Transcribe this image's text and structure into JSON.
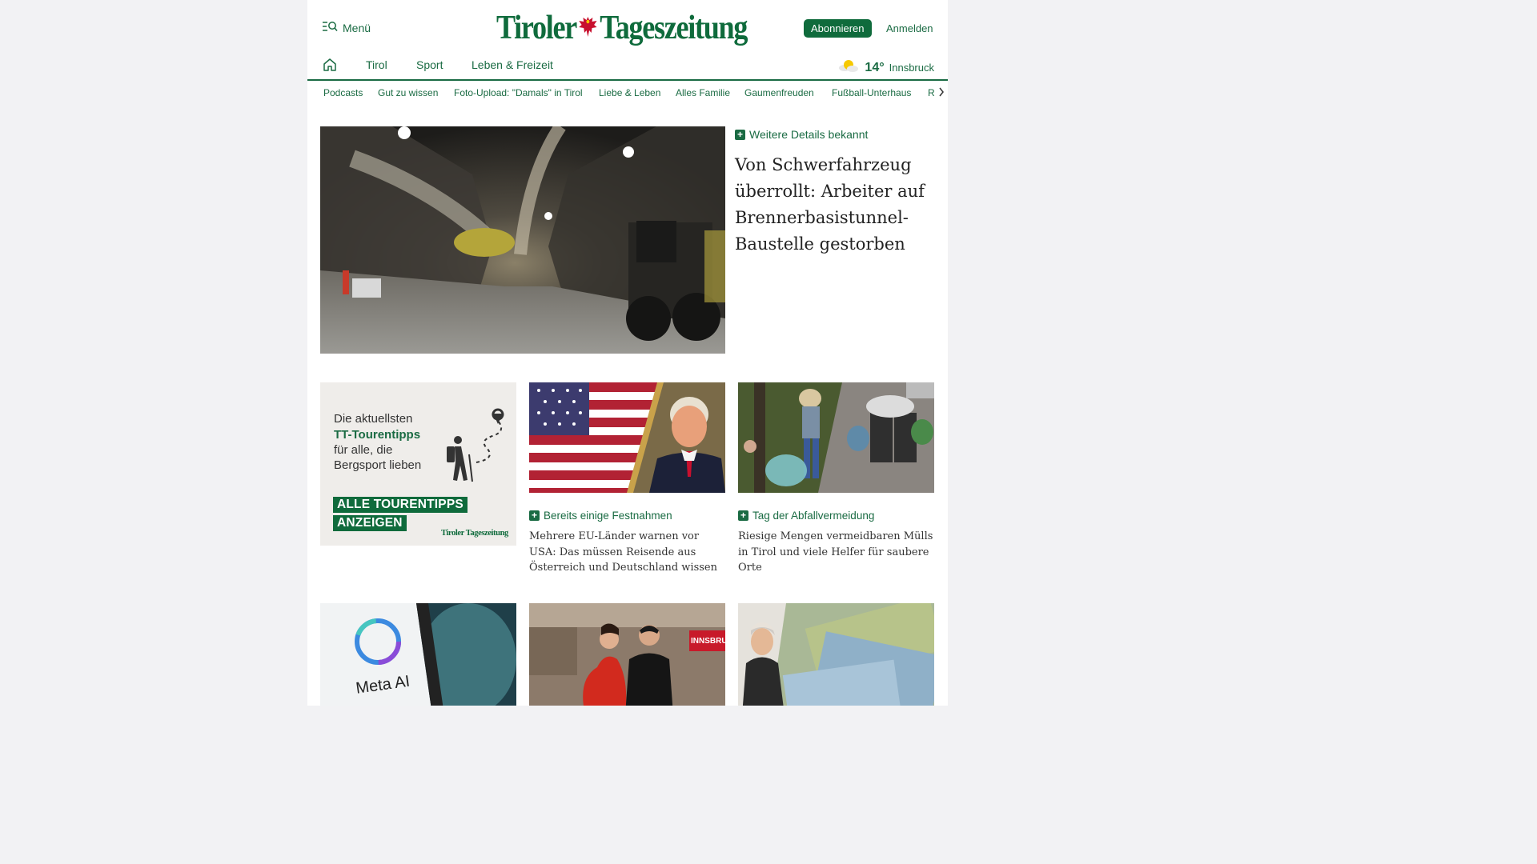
{
  "header": {
    "menu_label": "Menü",
    "logo_left": "Tiroler",
    "logo_right": "Tageszeitung",
    "subscribe_label": "Abonnieren",
    "login_label": "Anmelden"
  },
  "nav": {
    "items": [
      "Tirol",
      "Sport",
      "Leben & Freizeit"
    ]
  },
  "weather": {
    "temp": "14°",
    "city": "Innsbruck"
  },
  "subnav": {
    "items": [
      "Podcasts",
      "Gut zu wissen",
      "Foto-Upload: \"Damals\" in Tirol",
      "Liebe & Leben",
      "Alles Familie",
      "Gaumenfreuden",
      "Fußball-Unterhaus",
      "R"
    ]
  },
  "hero": {
    "kicker": "Weitere Details bekannt",
    "title": "Von Schwerfahrzeug überrollt: Arbeiter auf Brennerbasistunnel-Baustelle gestorben"
  },
  "ad": {
    "line1": "Die aktuellsten",
    "line2": "TT-Tourentipps",
    "line3": "für alle, die",
    "line4": "Bergsport lieben",
    "cta1": "ALLE TOURENTIPPS",
    "cta2": "ANZEIGEN",
    "brand": "Tiroler Tageszeitung"
  },
  "cards": [
    {
      "kicker": "Bereits einige Festnahmen",
      "title": "Mehrere EU-Länder warnen vor USA: Das müssen Reisende aus Österreich und Deutschland wissen"
    },
    {
      "kicker": "Tag der Abfallvermeidung",
      "title": "Riesige Mengen vermeidbaren Mülls in Tirol und viele Helfer für saubere Orte"
    }
  ],
  "bottom": {
    "meta_label": "Meta AI",
    "banner_text": "INNSBRUCK"
  },
  "colors": {
    "brand_green": "#0f6b3c",
    "link_green": "#1a6b43"
  }
}
